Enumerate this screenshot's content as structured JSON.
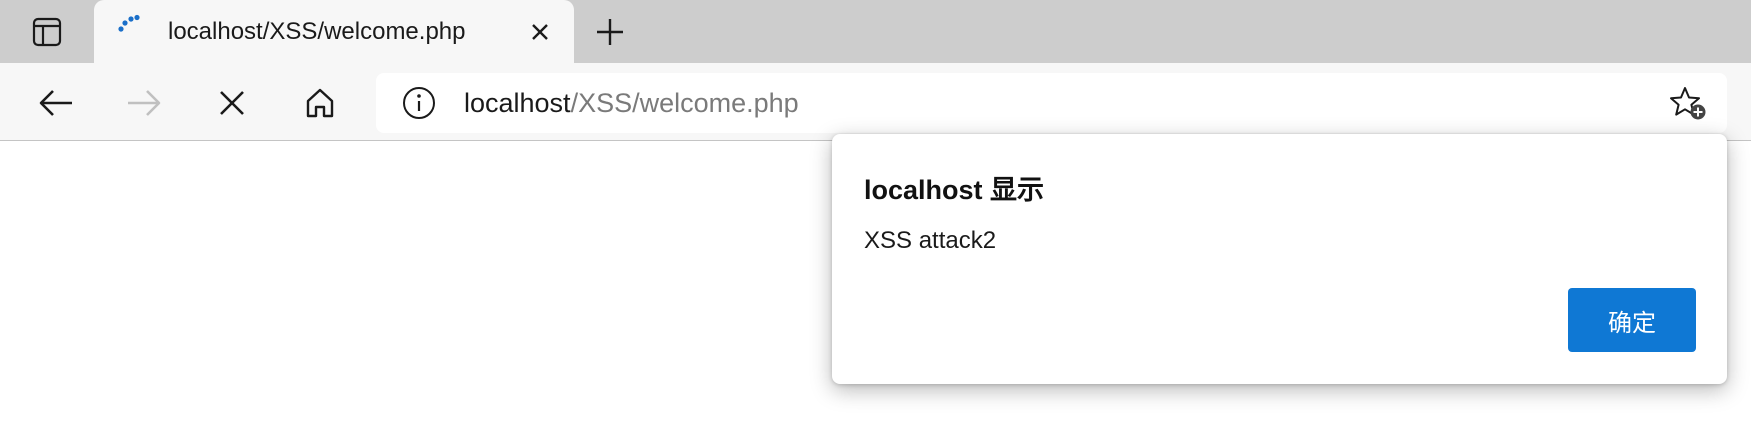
{
  "tab": {
    "title": "localhost/XSS/welcome.php",
    "loading": true
  },
  "toolbar": {
    "back_enabled": true,
    "forward_enabled": false,
    "reload_state": "stop"
  },
  "address_bar": {
    "host": "localhost",
    "path": "/XSS/welcome.php"
  },
  "dialog": {
    "title": "localhost 显示",
    "message": "XSS attack2",
    "ok_label": "确定"
  },
  "colors": {
    "tabstrip": "#cdcdcd",
    "toolbar": "#f7f7f7",
    "accent": "#0f78d4",
    "loading_spinner": "#1a6fc9",
    "disabled_icon": "#c0c0c0"
  },
  "icons": [
    "tab-actions-icon",
    "loading-spinner-icon",
    "close-icon",
    "plus-icon",
    "back-arrow-icon",
    "forward-arrow-icon",
    "stop-icon",
    "home-icon",
    "info-icon",
    "add-favorite-icon"
  ]
}
